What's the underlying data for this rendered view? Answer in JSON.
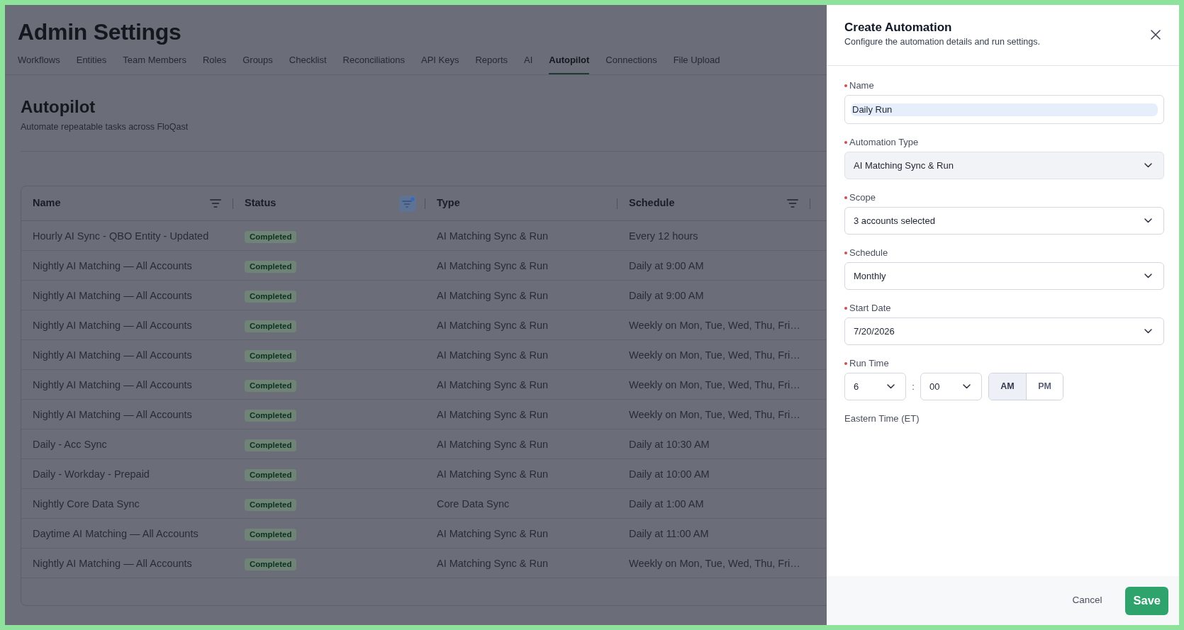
{
  "page": {
    "title": "Admin Settings",
    "tabs": [
      {
        "label": "Workflows",
        "selected": false
      },
      {
        "label": "Entities",
        "selected": false
      },
      {
        "label": "Team Members",
        "selected": false
      },
      {
        "label": "Roles",
        "selected": false
      },
      {
        "label": "Groups",
        "selected": false
      },
      {
        "label": "Checklist",
        "selected": false
      },
      {
        "label": "Reconciliations",
        "selected": false
      },
      {
        "label": "API Keys",
        "selected": false
      },
      {
        "label": "Reports",
        "selected": false
      },
      {
        "label": "AI",
        "selected": false
      },
      {
        "label": "Autopilot",
        "selected": true
      },
      {
        "label": "Connections",
        "selected": false
      },
      {
        "label": "File Upload",
        "selected": false
      }
    ]
  },
  "section": {
    "title": "Autopilot",
    "subtitle": "Automate repeatable tasks across FloQast"
  },
  "table": {
    "columns": [
      {
        "label": "Name",
        "filter": true,
        "filter_active": false
      },
      {
        "label": "Status",
        "filter": true,
        "filter_active": true
      },
      {
        "label": "Type",
        "filter": false
      },
      {
        "label": "Schedule",
        "filter": true,
        "filter_active": false
      }
    ],
    "rows": [
      {
        "name": "Hourly AI Sync - QBO Entity - Updated",
        "status": "Completed",
        "type": "AI Matching Sync & Run",
        "schedule": "Every 12 hours"
      },
      {
        "name": "Nightly AI Matching — All Accounts",
        "status": "Completed",
        "type": "AI Matching Sync & Run",
        "schedule": "Daily at 9:00 AM"
      },
      {
        "name": "Nightly AI Matching — All Accounts",
        "status": "Completed",
        "type": "AI Matching Sync & Run",
        "schedule": "Daily at 9:00 AM"
      },
      {
        "name": "Nightly AI Matching — All Accounts",
        "status": "Completed",
        "type": "AI Matching Sync & Run",
        "schedule": "Weekly on Mon, Tue, Wed, Thu, Fri…"
      },
      {
        "name": "Nightly AI Matching — All Accounts",
        "status": "Completed",
        "type": "AI Matching Sync & Run",
        "schedule": "Weekly on Mon, Tue, Wed, Thu, Fri…"
      },
      {
        "name": "Nightly AI Matching — All Accounts",
        "status": "Completed",
        "type": "AI Matching Sync & Run",
        "schedule": "Weekly on Mon, Tue, Wed, Thu, Fri…"
      },
      {
        "name": "Nightly AI Matching — All Accounts",
        "status": "Completed",
        "type": "AI Matching Sync & Run",
        "schedule": "Weekly on Mon, Tue, Wed, Thu, Fri…"
      },
      {
        "name": "Daily - Acc Sync",
        "status": "Completed",
        "type": "AI Matching Sync & Run",
        "schedule": "Daily at 10:30 AM"
      },
      {
        "name": "Daily - Workday - Prepaid",
        "status": "Completed",
        "type": "AI Matching Sync & Run",
        "schedule": "Daily at 10:00 AM"
      },
      {
        "name": "Nightly Core Data Sync",
        "status": "Completed",
        "type": "Core Data Sync",
        "schedule": "Daily at 1:00 AM"
      },
      {
        "name": "Daytime AI Matching — All Accounts",
        "status": "Completed",
        "type": "AI Matching Sync & Run",
        "schedule": "Daily at 11:00 AM"
      },
      {
        "name": "Nightly AI Matching — All Accounts",
        "status": "Completed",
        "type": "AI Matching Sync & Run",
        "schedule": "Weekly on Mon, Tue, Wed, Thu, Fri…"
      }
    ]
  },
  "drawer": {
    "title": "Create Automation",
    "subtitle": "Configure the automation details and run settings.",
    "fields": [
      {
        "kind": "text",
        "label": "Name",
        "required": true,
        "value": "Daily Run",
        "autofilled": true
      },
      {
        "kind": "select",
        "label": "Automation Type",
        "required": true,
        "value": "AI Matching Sync & Run",
        "disabled": true
      },
      {
        "kind": "select",
        "label": "Scope",
        "required": true,
        "value": "3 accounts selected",
        "disabled": false
      },
      {
        "kind": "select",
        "label": "Schedule",
        "required": true,
        "value": "Monthly",
        "disabled": false
      },
      {
        "kind": "select",
        "label": "Start Date",
        "required": true,
        "value": "7/20/2026",
        "disabled": false
      },
      {
        "kind": "time",
        "label": "Run Time",
        "required": true,
        "hour": "6",
        "separator": ":",
        "minute": "00",
        "periods": [
          {
            "label": "AM",
            "selected": true
          },
          {
            "label": "PM",
            "selected": false
          }
        ]
      }
    ],
    "timezone": "Eastern Time (ET)",
    "buttons": [
      {
        "kind": "secondary",
        "label": "Cancel"
      },
      {
        "kind": "primary",
        "label": "Save"
      }
    ]
  }
}
